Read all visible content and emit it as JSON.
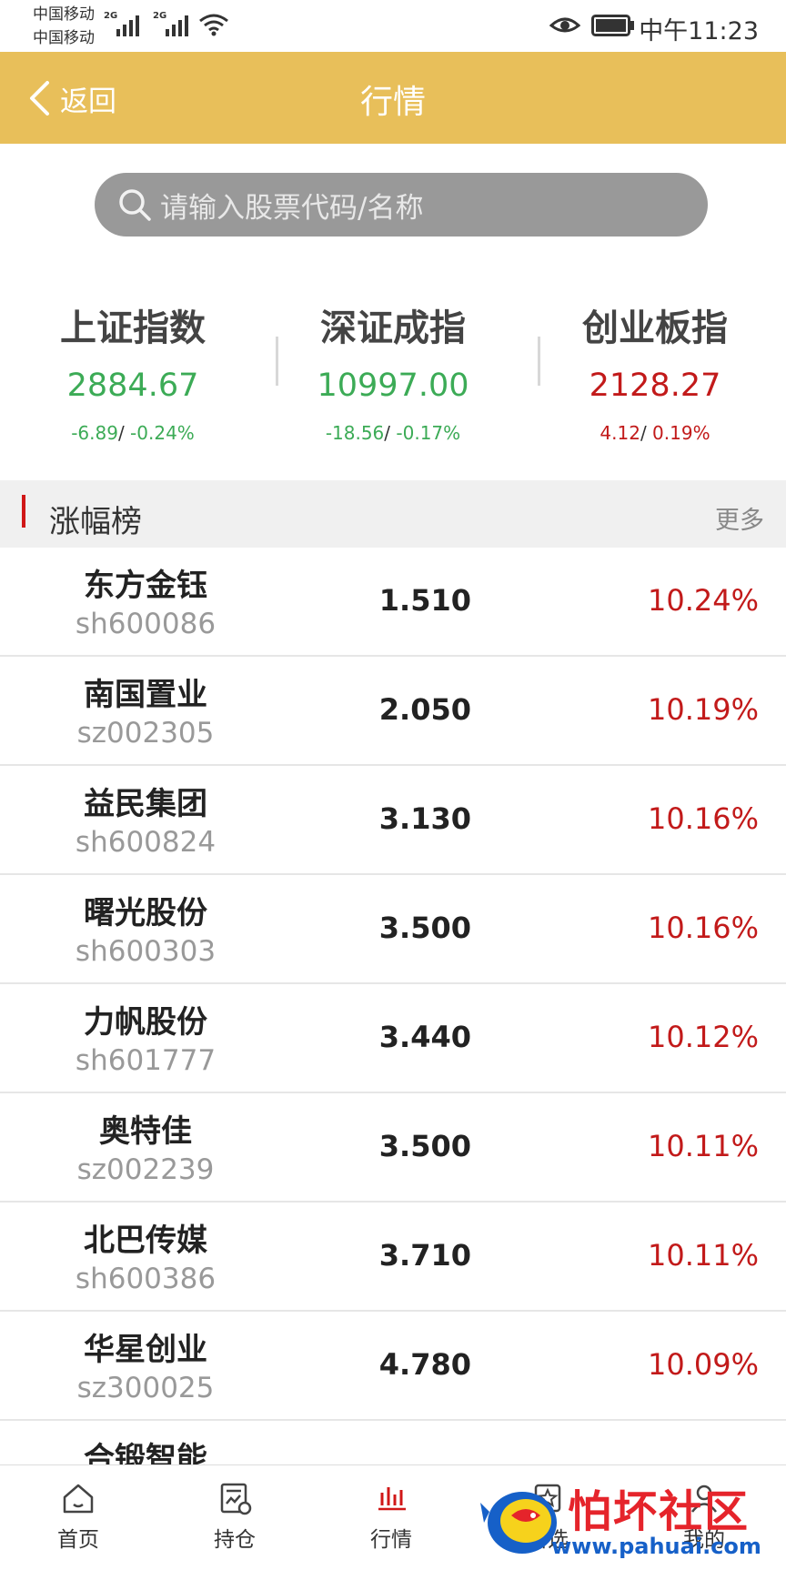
{
  "status_bar": {
    "carrier_1": "中国移动",
    "carrier_2": "中国移动",
    "network_1": "2G",
    "network_2": "2G",
    "time": "中午11:23"
  },
  "nav": {
    "back_label": "返回",
    "title": "行情"
  },
  "search": {
    "placeholder": "请输入股票代码/名称"
  },
  "indices": [
    {
      "name": "上证指数",
      "value": "2884.67",
      "change": "-6.89",
      "pct": "-0.24%"
    },
    {
      "name": "深证成指",
      "value": "10997.00",
      "change": "-18.56",
      "pct": "-0.17%"
    },
    {
      "name": "创业板指",
      "value": "2128.27",
      "change": "4.12",
      "pct": "0.19%"
    }
  ],
  "section": {
    "title": "涨幅榜",
    "more": "更多"
  },
  "stocks": [
    {
      "name": "东方金钰",
      "code": "sh600086",
      "price": "1.510",
      "pct": "10.24%"
    },
    {
      "name": "南国置业",
      "code": "sz002305",
      "price": "2.050",
      "pct": "10.19%"
    },
    {
      "name": "益民集团",
      "code": "sh600824",
      "price": "3.130",
      "pct": "10.16%"
    },
    {
      "name": "曙光股份",
      "code": "sh600303",
      "price": "3.500",
      "pct": "10.16%"
    },
    {
      "name": "力帆股份",
      "code": "sh601777",
      "price": "3.440",
      "pct": "10.12%"
    },
    {
      "name": "奥特佳",
      "code": "sz002239",
      "price": "3.500",
      "pct": "10.11%"
    },
    {
      "name": "北巴传媒",
      "code": "sh600386",
      "price": "3.710",
      "pct": "10.11%"
    },
    {
      "name": "华星创业",
      "code": "sz300025",
      "price": "4.780",
      "pct": "10.09%"
    },
    {
      "name": "合锻智能",
      "code": "",
      "price": "",
      "pct": ""
    }
  ],
  "tabs": [
    {
      "label": "首页",
      "icon": "home-icon"
    },
    {
      "label": "持仓",
      "icon": "holdings-icon"
    },
    {
      "label": "行情",
      "icon": "market-icon"
    },
    {
      "label": "自选",
      "icon": "favorites-icon"
    },
    {
      "label": "我的",
      "icon": "profile-icon"
    }
  ],
  "watermark": {
    "text": "怕坏社区",
    "url": "www.pahuai.com"
  },
  "colors": {
    "nav_bg": "#e8bf5a",
    "up_red": "#c21a1a",
    "down_green": "#3cab56",
    "accent_red": "#d01717"
  }
}
